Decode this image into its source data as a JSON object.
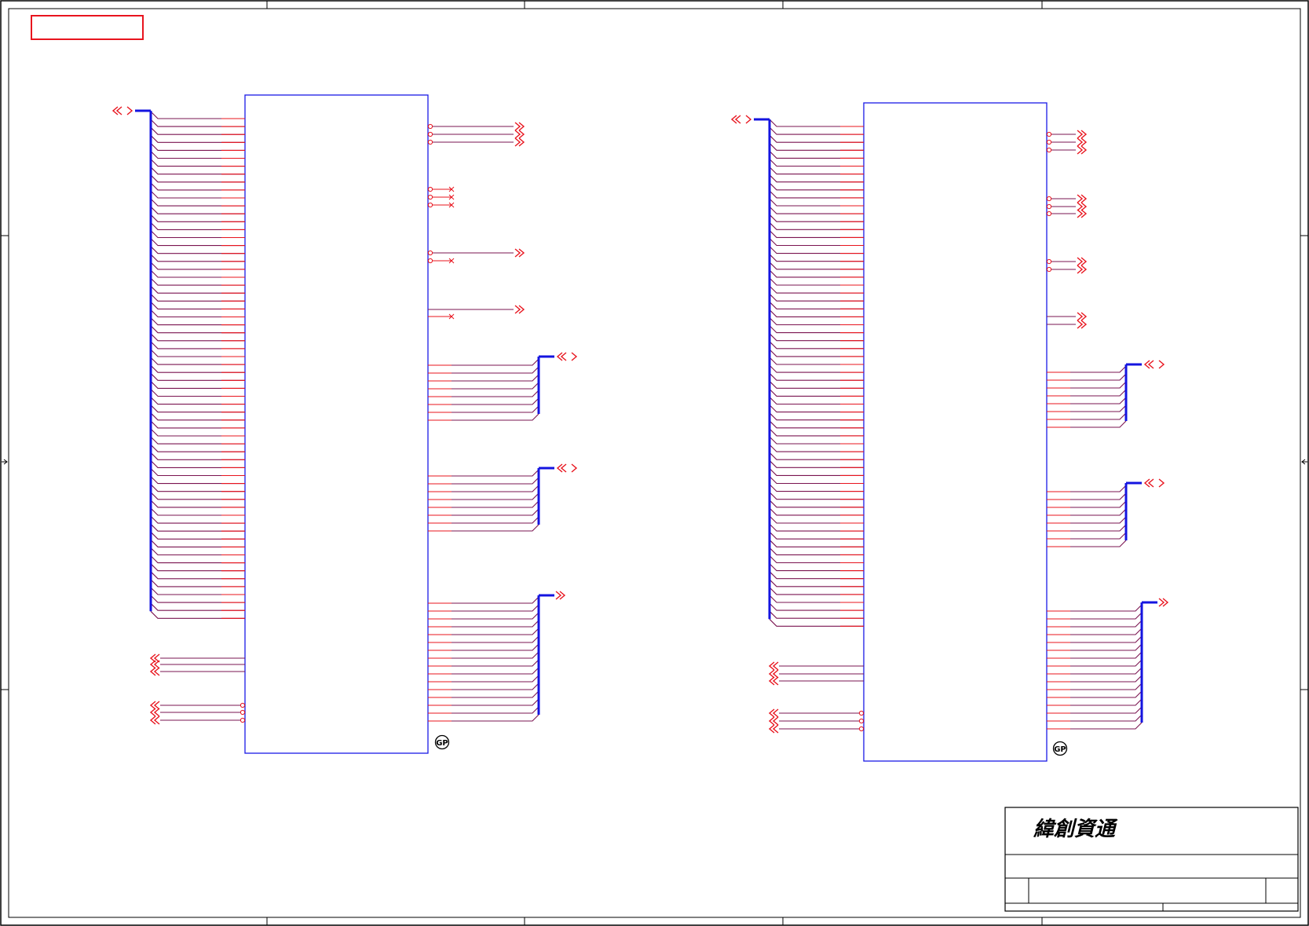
{
  "title_block": {
    "company": "緯創資通"
  },
  "logos": {
    "left": "GP",
    "right": "GP"
  },
  "colors": {
    "wire": "#e8141e",
    "wire_dark": "#7a1450",
    "bus": "#1414e0",
    "chip_outline": "#1a1ae6",
    "highlight_box": "#e8141e",
    "frame": "#000000"
  },
  "icons": {
    "bus_port": "double-chevron-bidirectional",
    "output_port": "double-chevron-right",
    "input_port": "double-chevron-left",
    "no_connect": "x-mark",
    "inversion": "circle-bubble",
    "logo": "gp-seal"
  },
  "wire_counts": {
    "left_main_bus": 64,
    "right_main_bus": 64,
    "small_group": 8,
    "large_group": 16,
    "control_group": 3
  }
}
